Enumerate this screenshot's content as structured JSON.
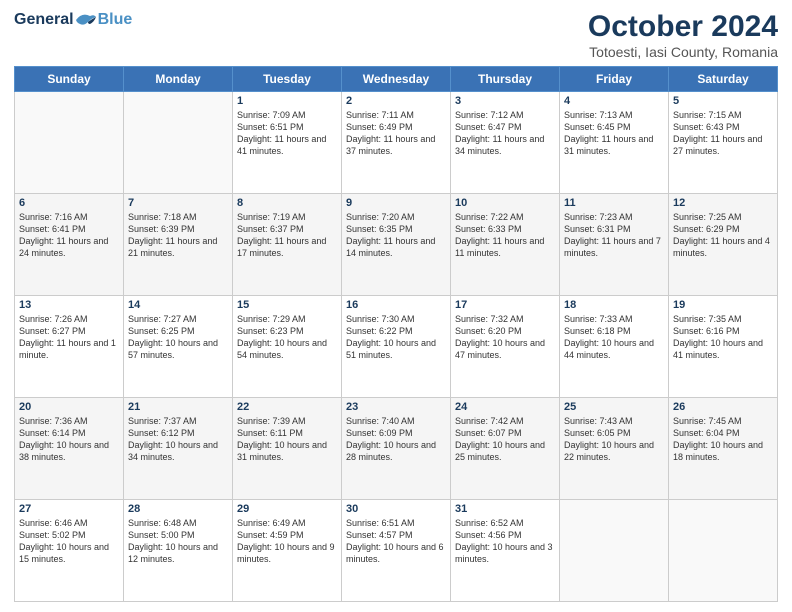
{
  "header": {
    "logo_general": "General",
    "logo_blue": "Blue",
    "title": "October 2024",
    "subtitle": "Totoesti, Iasi County, Romania"
  },
  "days_of_week": [
    "Sunday",
    "Monday",
    "Tuesday",
    "Wednesday",
    "Thursday",
    "Friday",
    "Saturday"
  ],
  "weeks": [
    [
      {
        "day": "",
        "content": ""
      },
      {
        "day": "",
        "content": ""
      },
      {
        "day": "1",
        "content": "Sunrise: 7:09 AM\nSunset: 6:51 PM\nDaylight: 11 hours and 41 minutes."
      },
      {
        "day": "2",
        "content": "Sunrise: 7:11 AM\nSunset: 6:49 PM\nDaylight: 11 hours and 37 minutes."
      },
      {
        "day": "3",
        "content": "Sunrise: 7:12 AM\nSunset: 6:47 PM\nDaylight: 11 hours and 34 minutes."
      },
      {
        "day": "4",
        "content": "Sunrise: 7:13 AM\nSunset: 6:45 PM\nDaylight: 11 hours and 31 minutes."
      },
      {
        "day": "5",
        "content": "Sunrise: 7:15 AM\nSunset: 6:43 PM\nDaylight: 11 hours and 27 minutes."
      }
    ],
    [
      {
        "day": "6",
        "content": "Sunrise: 7:16 AM\nSunset: 6:41 PM\nDaylight: 11 hours and 24 minutes."
      },
      {
        "day": "7",
        "content": "Sunrise: 7:18 AM\nSunset: 6:39 PM\nDaylight: 11 hours and 21 minutes."
      },
      {
        "day": "8",
        "content": "Sunrise: 7:19 AM\nSunset: 6:37 PM\nDaylight: 11 hours and 17 minutes."
      },
      {
        "day": "9",
        "content": "Sunrise: 7:20 AM\nSunset: 6:35 PM\nDaylight: 11 hours and 14 minutes."
      },
      {
        "day": "10",
        "content": "Sunrise: 7:22 AM\nSunset: 6:33 PM\nDaylight: 11 hours and 11 minutes."
      },
      {
        "day": "11",
        "content": "Sunrise: 7:23 AM\nSunset: 6:31 PM\nDaylight: 11 hours and 7 minutes."
      },
      {
        "day": "12",
        "content": "Sunrise: 7:25 AM\nSunset: 6:29 PM\nDaylight: 11 hours and 4 minutes."
      }
    ],
    [
      {
        "day": "13",
        "content": "Sunrise: 7:26 AM\nSunset: 6:27 PM\nDaylight: 11 hours and 1 minute."
      },
      {
        "day": "14",
        "content": "Sunrise: 7:27 AM\nSunset: 6:25 PM\nDaylight: 10 hours and 57 minutes."
      },
      {
        "day": "15",
        "content": "Sunrise: 7:29 AM\nSunset: 6:23 PM\nDaylight: 10 hours and 54 minutes."
      },
      {
        "day": "16",
        "content": "Sunrise: 7:30 AM\nSunset: 6:22 PM\nDaylight: 10 hours and 51 minutes."
      },
      {
        "day": "17",
        "content": "Sunrise: 7:32 AM\nSunset: 6:20 PM\nDaylight: 10 hours and 47 minutes."
      },
      {
        "day": "18",
        "content": "Sunrise: 7:33 AM\nSunset: 6:18 PM\nDaylight: 10 hours and 44 minutes."
      },
      {
        "day": "19",
        "content": "Sunrise: 7:35 AM\nSunset: 6:16 PM\nDaylight: 10 hours and 41 minutes."
      }
    ],
    [
      {
        "day": "20",
        "content": "Sunrise: 7:36 AM\nSunset: 6:14 PM\nDaylight: 10 hours and 38 minutes."
      },
      {
        "day": "21",
        "content": "Sunrise: 7:37 AM\nSunset: 6:12 PM\nDaylight: 10 hours and 34 minutes."
      },
      {
        "day": "22",
        "content": "Sunrise: 7:39 AM\nSunset: 6:11 PM\nDaylight: 10 hours and 31 minutes."
      },
      {
        "day": "23",
        "content": "Sunrise: 7:40 AM\nSunset: 6:09 PM\nDaylight: 10 hours and 28 minutes."
      },
      {
        "day": "24",
        "content": "Sunrise: 7:42 AM\nSunset: 6:07 PM\nDaylight: 10 hours and 25 minutes."
      },
      {
        "day": "25",
        "content": "Sunrise: 7:43 AM\nSunset: 6:05 PM\nDaylight: 10 hours and 22 minutes."
      },
      {
        "day": "26",
        "content": "Sunrise: 7:45 AM\nSunset: 6:04 PM\nDaylight: 10 hours and 18 minutes."
      }
    ],
    [
      {
        "day": "27",
        "content": "Sunrise: 6:46 AM\nSunset: 5:02 PM\nDaylight: 10 hours and 15 minutes."
      },
      {
        "day": "28",
        "content": "Sunrise: 6:48 AM\nSunset: 5:00 PM\nDaylight: 10 hours and 12 minutes."
      },
      {
        "day": "29",
        "content": "Sunrise: 6:49 AM\nSunset: 4:59 PM\nDaylight: 10 hours and 9 minutes."
      },
      {
        "day": "30",
        "content": "Sunrise: 6:51 AM\nSunset: 4:57 PM\nDaylight: 10 hours and 6 minutes."
      },
      {
        "day": "31",
        "content": "Sunrise: 6:52 AM\nSunset: 4:56 PM\nDaylight: 10 hours and 3 minutes."
      },
      {
        "day": "",
        "content": ""
      },
      {
        "day": "",
        "content": ""
      }
    ]
  ]
}
